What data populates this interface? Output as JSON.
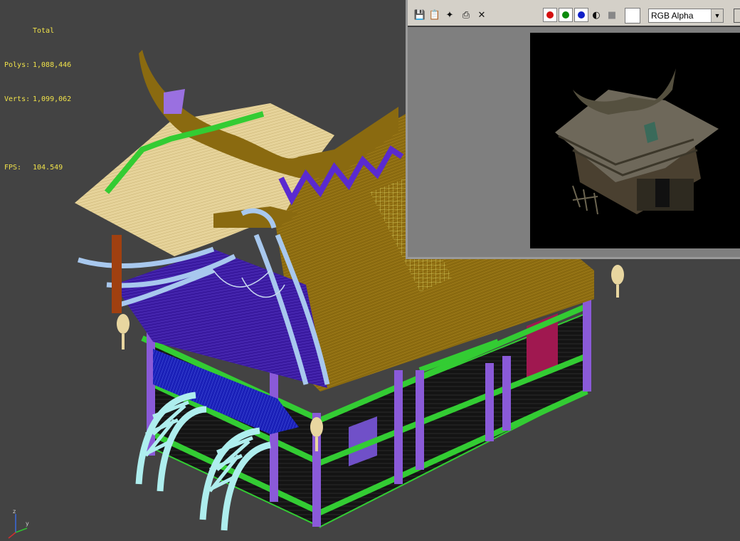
{
  "stats": {
    "total_label": "Total",
    "polys_label": "Polys:",
    "polys_value": "1,088,446",
    "verts_label": "Verts:",
    "verts_value": "1,099,062",
    "fps_label": "FPS:",
    "fps_value": "104.549"
  },
  "axis": {
    "x": "x",
    "y": "y",
    "z": "z"
  },
  "render_window": {
    "toolbar_icons": [
      "save-icon",
      "copy-icon",
      "clone-icon",
      "print-icon",
      "clear-icon"
    ],
    "channel_select": "RGB Alpha",
    "channel_colors": {
      "red": "#d41010",
      "green": "#0a8a0a",
      "blue": "#1020c8"
    }
  },
  "colors": {
    "viewport_bg": "#434343",
    "stats_text": "#f0e24a",
    "roof_thatch": "#8a6a10",
    "roof_light": "#e8d6a0",
    "purple": "#8a5ad8",
    "green": "#33cc33",
    "light_blue": "#a8c8ee",
    "cyan": "#aaeeee"
  }
}
